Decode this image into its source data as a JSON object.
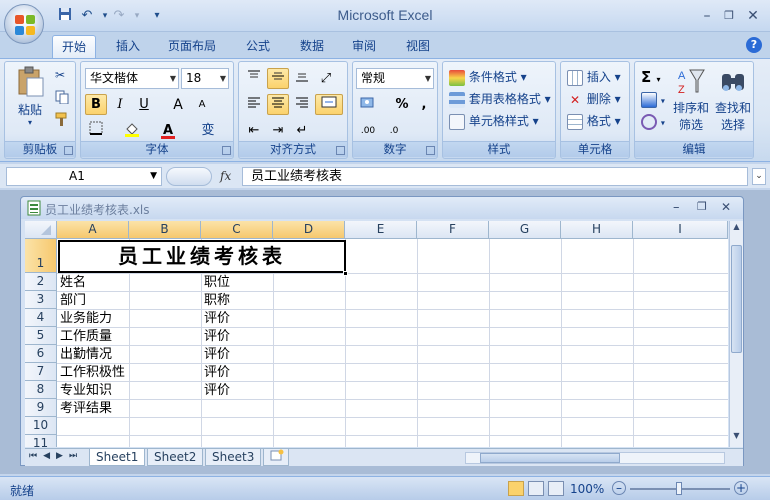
{
  "app": {
    "title": "Microsoft Excel",
    "window_controls": [
      "minimize",
      "restore",
      "close"
    ]
  },
  "ribbon": {
    "tabs": [
      "开始",
      "插入",
      "页面布局",
      "公式",
      "数据",
      "审阅",
      "视图"
    ],
    "active_tab": "开始",
    "groups": {
      "clipboard": {
        "label": "剪贴板",
        "paste": "粘贴"
      },
      "font": {
        "label": "字体",
        "font_name": "华文楷体",
        "font_size": "18",
        "bold": "B",
        "italic": "I",
        "underline": "U",
        "grow": "A",
        "shrink": "A",
        "wen": "变"
      },
      "alignment": {
        "label": "对齐方式"
      },
      "number": {
        "label": "数字",
        "format": "常规",
        "percent": "%",
        "comma": ",",
        "inc": ".00",
        "dec": ".0"
      },
      "styles": {
        "label": "样式",
        "conditional": "条件格式",
        "table": "套用表格格式",
        "cell": "单元格样式"
      },
      "cells": {
        "label": "单元格",
        "insert": "插入",
        "delete": "删除",
        "format": "格式"
      },
      "editing": {
        "label": "编辑",
        "sum": "Σ",
        "sort": "排序和",
        "sort2": "筛选",
        "find": "查找和",
        "find2": "选择"
      }
    }
  },
  "formula_bar": {
    "name_box": "A1",
    "fx": "fx",
    "value": "员工业绩考核表"
  },
  "workbook": {
    "filename": "员工业绩考核表.xls",
    "columns": [
      "A",
      "B",
      "C",
      "D",
      "E",
      "F",
      "G",
      "H",
      "I"
    ],
    "rows": [
      "1",
      "2",
      "3",
      "4",
      "5",
      "6",
      "7",
      "8",
      "9",
      "10",
      "11"
    ],
    "title": "员工业绩考核表",
    "col_a": [
      "姓名",
      "部门",
      "业务能力",
      "工作质量",
      "出勤情况",
      "工作积极性",
      "专业知识",
      "考评结果"
    ],
    "col_c": [
      "职位",
      "职称",
      "评价",
      "评价",
      "评价",
      "评价",
      "评价"
    ],
    "sheets": [
      "Sheet1",
      "Sheet2",
      "Sheet3"
    ],
    "active_sheet": "Sheet1"
  },
  "status": {
    "text": "就绪",
    "zoom": "100%"
  },
  "colors": {
    "accent": "#15428b",
    "selected_header": "#f6c86e"
  }
}
